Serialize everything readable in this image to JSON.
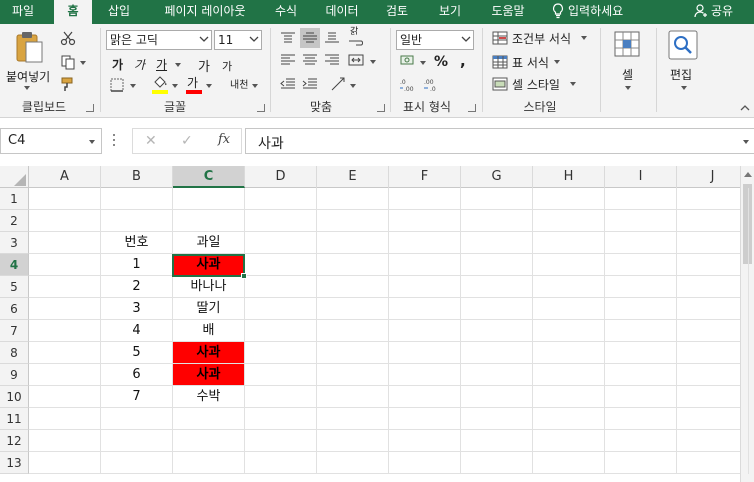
{
  "menu": {
    "tabs": [
      {
        "label": "파일",
        "active": false
      },
      {
        "label": "홈",
        "active": true
      },
      {
        "label": "삽입",
        "active": false
      },
      {
        "label": "페이지 레이아웃",
        "active": false
      },
      {
        "label": "수식",
        "active": false
      },
      {
        "label": "데이터",
        "active": false
      },
      {
        "label": "검토",
        "active": false
      },
      {
        "label": "보기",
        "active": false
      },
      {
        "label": "도움말",
        "active": false
      }
    ],
    "search_label": "입력하세요",
    "share_label": "공유"
  },
  "ribbon": {
    "clipboard": {
      "paste_label": "붙여넣기",
      "group_label": "클립보드"
    },
    "font": {
      "font_name": "맑은 고딕",
      "font_size": "11",
      "bold": "가",
      "italic": "가",
      "underline": "가",
      "increase": "가",
      "decrease": "가",
      "font_color_glyph": "가",
      "phonetic": "내천",
      "group_label": "글꼴"
    },
    "alignment": {
      "wrap_glyph": "갉",
      "group_label": "맞춤"
    },
    "number": {
      "format": "일반",
      "percent": "%",
      "comma": ",",
      "group_label": "표시 형식"
    },
    "styles": {
      "conditional": "조건부 서식",
      "table": "표 서식",
      "cell_styles": "셀 스타일",
      "group_label": "스타일"
    },
    "cells": {
      "label": "셀"
    },
    "editing": {
      "label": "편집"
    },
    "colors": {
      "accent": "#217346",
      "highlight_yellow": "#ffff00",
      "font_red": "#ff0000"
    }
  },
  "formula_bar": {
    "name_box": "C4",
    "cancel_glyph": "✕",
    "enter_glyph": "✓",
    "fx_label": "fx",
    "content": "사과"
  },
  "sheet": {
    "columns": [
      "A",
      "B",
      "C",
      "D",
      "E",
      "F",
      "G",
      "H",
      "I",
      "J"
    ],
    "rows": [
      "1",
      "2",
      "3",
      "4",
      "5",
      "6",
      "7",
      "8",
      "9",
      "10",
      "11",
      "12",
      "13"
    ],
    "selected_cell": "C4",
    "fill_red": "#ff0000",
    "header": {
      "B": "번호",
      "C": "과일"
    },
    "data": [
      {
        "B": "1",
        "C": "사과",
        "red": true
      },
      {
        "B": "2",
        "C": "바나나",
        "red": false
      },
      {
        "B": "3",
        "C": "딸기",
        "red": false
      },
      {
        "B": "4",
        "C": "배",
        "red": false
      },
      {
        "B": "5",
        "C": "사과",
        "red": true
      },
      {
        "B": "6",
        "C": "사과",
        "red": true
      },
      {
        "B": "7",
        "C": "수박",
        "red": false
      }
    ]
  }
}
